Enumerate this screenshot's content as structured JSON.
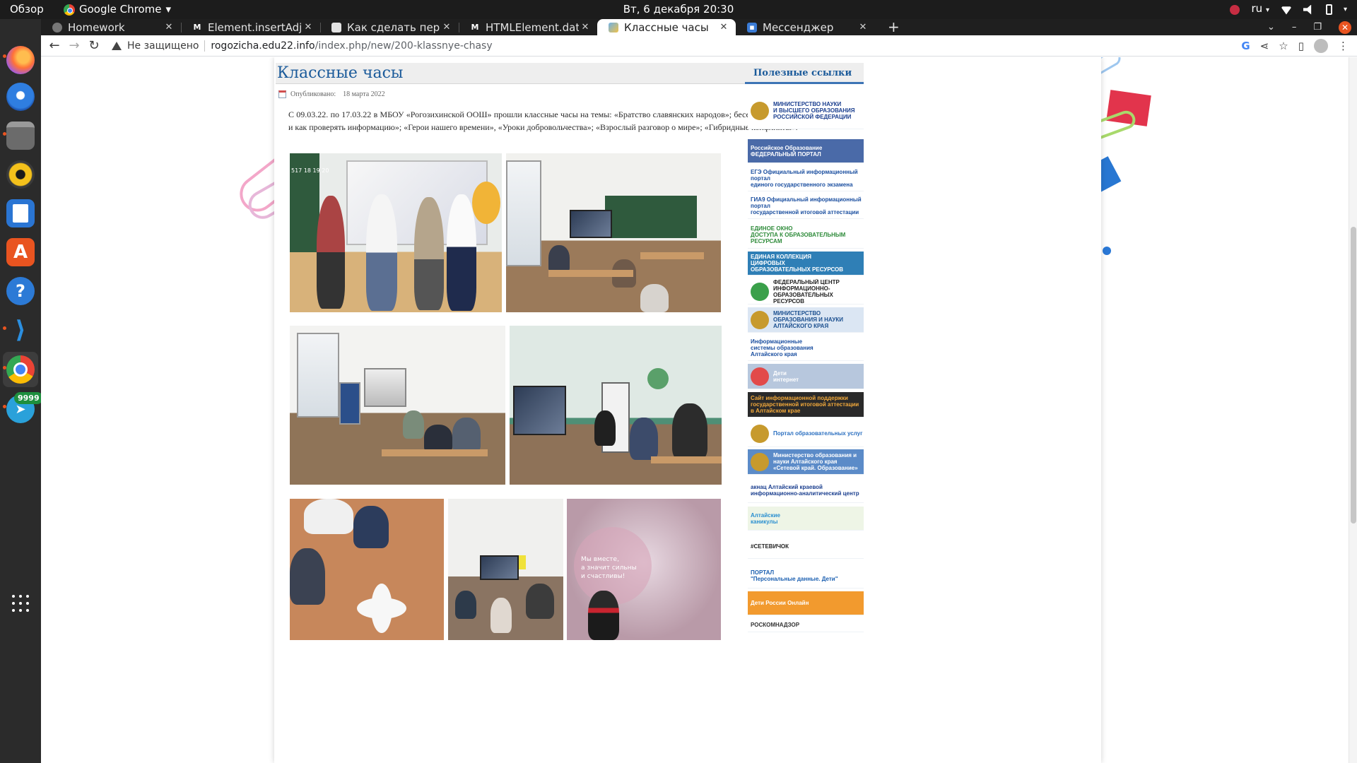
{
  "top_bar": {
    "overview": "Обзор",
    "app_name": "Google Chrome",
    "app_caret": "▾",
    "clock": "Вт, 6 декабря  20:30",
    "lang": "ru",
    "lang_caret": "▾",
    "tray_caret": "▾"
  },
  "dock": {
    "apps": [
      "Firefox",
      "Thunderbird",
      "Files",
      "Rhythmbox",
      "LibreOffice Writer",
      "Ubuntu Software",
      "Help",
      "Visual Studio Code",
      "Google Chrome",
      "Telegram"
    ],
    "telegram_badge": "9999"
  },
  "tabs": [
    {
      "title": "Homework",
      "active": false
    },
    {
      "title": "Element.insertAdjacentH",
      "active": false
    },
    {
      "title": "Как сделать перенос стр",
      "active": false
    },
    {
      "title": "HTMLElement.dataset - W",
      "active": false
    },
    {
      "title": "Классные часы",
      "active": true
    },
    {
      "title": "Мессенджер",
      "active": false
    }
  ],
  "tab_close": "✕",
  "new_tab": "+",
  "window_controls": {
    "list": "⌄",
    "minimize": "–",
    "restore": "❐",
    "close": "✕"
  },
  "address_bar": {
    "security_label": "Не защищено",
    "host": "rogozicha.edu22.info",
    "path": "/index.php/new/200-klassnye-chasy"
  },
  "nav": {
    "back": "←",
    "forward": "→",
    "reload": "↻"
  },
  "article": {
    "title": "Классные часы",
    "published_prefix": "Опубликовано:",
    "published_date": "18 марта 2022",
    "body": "С 09.03.22. по 17.03.22 в МБОУ «Рогозихинской ООШ» прошли классные часы на темы: «Братство славянских народов»; беседа «Что такое «фейки» и как проверять информацию»; «Герои нашего времени», «Уроки добровольчества»;  «Взрослый разговор о мире»; «Гибридные конфликты».",
    "photo_overlay_1": "517 18 19 20",
    "photo_overlay_7": "Мы вместе,\nа значит сильны\nи счастливы!"
  },
  "sidebar": {
    "title": "Полезные ссылки",
    "banners": [
      {
        "text": "МИНИСТЕРСТВО НАУКИ\nИ ВЫСШЕГО ОБРАЗОВАНИЯ\nРОССИЙСКОЙ ФЕДЕРАЦИИ",
        "bg": "#ffffff",
        "fg": "#1b3f8f",
        "logo": "#c79a2d"
      },
      {
        "text": "Российское Образование\nФЕДЕРАЛЬНЫЙ ПОРТАЛ",
        "bg": "#4a6aa8",
        "fg": "#ffffff",
        "logo": ""
      },
      {
        "text": "ЕГЭ   Официальный информационный портал\nединого государственного экзамена",
        "bg": "#ffffff",
        "fg": "#1b4fa0",
        "logo": ""
      },
      {
        "text": "ГИА9  Официальный информационный портал\nгосударственной итоговой аттестации",
        "bg": "#ffffff",
        "fg": "#1b4fa0",
        "logo": ""
      },
      {
        "text": "ЕДИНОЕ ОКНО\nДОСТУПА К ОБРАЗОВАТЕЛЬНЫМ РЕСУРСАМ",
        "bg": "#ffffff",
        "fg": "#2e8b3a",
        "logo": ""
      },
      {
        "text": "ЕДИНАЯ КОЛЛЕКЦИЯ\nЦИФРОВЫХ\nОБРАЗОВАТЕЛЬНЫХ РЕСУРСОВ",
        "bg": "#2f7fb6",
        "fg": "#ffffff",
        "logo": ""
      },
      {
        "text": "ФЕДЕРАЛЬНЫЙ ЦЕНТР\nИНФОРМАЦИОННО-ОБРАЗОВАТЕЛЬНЫХ\nРЕСУРСОВ",
        "bg": "#ffffff",
        "fg": "#222222",
        "logo": "#3aa04a"
      },
      {
        "text": "МИНИСТЕРСТВО\nОБРАЗОВАНИЯ И НАУКИ\nАЛТАЙСКОГО КРАЯ",
        "bg": "#dbe6f3",
        "fg": "#1b4f8f",
        "logo": "#c79a2d"
      },
      {
        "text": "Информационные\nсистемы образования\nАлтайского края",
        "bg": "#ffffff",
        "fg": "#1b4fa0",
        "logo": ""
      },
      {
        "text": "Дети\nинтернет",
        "bg": "#b7c7dd",
        "fg": "#ffffff",
        "logo": "#e24a4a"
      },
      {
        "text": "Сайт информационной поддержки\nгосударственной итоговой аттестации\nв Алтайском крае",
        "bg": "#2a2a2a",
        "fg": "#f2a93b",
        "logo": ""
      },
      {
        "text": "Портал образовательных услуг",
        "bg": "#ffffff",
        "fg": "#2a6fc0",
        "logo": "#c79a2d"
      },
      {
        "text": "Министерство образования и науки Алтайского края\n«Сетевой край. Образование»",
        "bg": "#5b8bc8",
        "fg": "#ffffff",
        "logo": "#c79a2d"
      },
      {
        "text": "акнац  Алтайский краевой\nинформационно-аналитический центр",
        "bg": "#ffffff",
        "fg": "#1b3f8f",
        "logo": ""
      },
      {
        "text": "Алтайские\nканикулы",
        "bg": "#eef5e6",
        "fg": "#2a8fd0",
        "logo": ""
      },
      {
        "text": "#СЕТЕВИЧОК",
        "bg": "#ffffff",
        "fg": "#222222",
        "logo": ""
      },
      {
        "text": "ПОРТАЛ\n\"Персональные данные. Дети\"",
        "bg": "#ffffff",
        "fg": "#1b5fb0",
        "logo": ""
      },
      {
        "text": "Дети России Онлайн",
        "bg": "#f29a2e",
        "fg": "#ffffff",
        "logo": ""
      },
      {
        "text": "РОСКОМНАДЗОР",
        "bg": "#ffffff",
        "fg": "#333333",
        "logo": ""
      }
    ]
  },
  "colors": {
    "title_blue": "#1a5a9a",
    "sidebar_accent": "#3d74b5",
    "ubuntu_orange": "#e95420"
  }
}
